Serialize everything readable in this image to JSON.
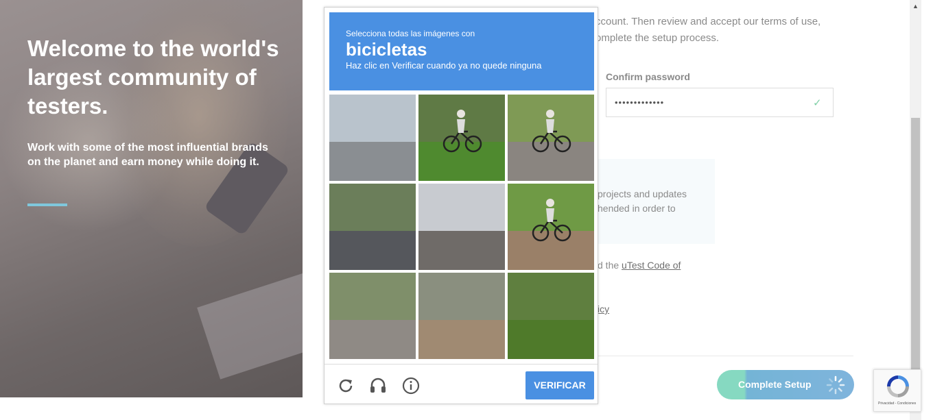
{
  "hero": {
    "heading": "Welcome to the world's largest community of testers.",
    "subheading": "Work with some of the most influential brands on the planet and earn money while doing it."
  },
  "form": {
    "intro_text": "ccount. Then review and accept our terms of use, omplete the setup process.",
    "confirm_password_label": "Confirm password",
    "confirm_password_value": "•••••••••••••",
    "info_text": "projects and updates hended in order to",
    "code_prefix": "d the ",
    "code_link": "uTest Code of",
    "policy_link": "icy",
    "submit_label": "Complete Setup"
  },
  "captcha": {
    "instruction": "Selecciona todas las imágenes con",
    "target": "bicicletas",
    "hint": "Haz clic en Verificar cuando ya no quede ninguna",
    "verify_label": "VERIFICAR",
    "tiles": [
      {
        "scene": "street-lights",
        "sky": "#b9c3cc",
        "ground": "#8a8e92",
        "has_bike": false
      },
      {
        "scene": "cyclist-grass",
        "sky": "#5f7a45",
        "ground": "#4f8a2f",
        "has_bike": true
      },
      {
        "scene": "cyclist-road",
        "sky": "#7f9a55",
        "ground": "#8a8580",
        "has_bike": true
      },
      {
        "scene": "road-car",
        "sky": "#6b7e5a",
        "ground": "#55575c",
        "has_bike": false
      },
      {
        "scene": "city-towers",
        "sky": "#c8cbd0",
        "ground": "#6f6b68",
        "has_bike": false
      },
      {
        "scene": "cyclist-curb",
        "sky": "#6f9a45",
        "ground": "#9a8068",
        "has_bike": true
      },
      {
        "scene": "street-car",
        "sky": "#7f8f6a",
        "ground": "#8f8a85",
        "has_bike": false
      },
      {
        "scene": "tractor-field",
        "sky": "#8a8f7f",
        "ground": "#a08a72",
        "has_bike": false
      },
      {
        "scene": "bushes",
        "sky": "#5f7f3f",
        "ground": "#4f7a2a",
        "has_bike": false
      }
    ],
    "icons": [
      "reload-icon",
      "audio-icon",
      "info-icon"
    ]
  },
  "badge": {
    "links": "Privacidad - Condiciones"
  }
}
